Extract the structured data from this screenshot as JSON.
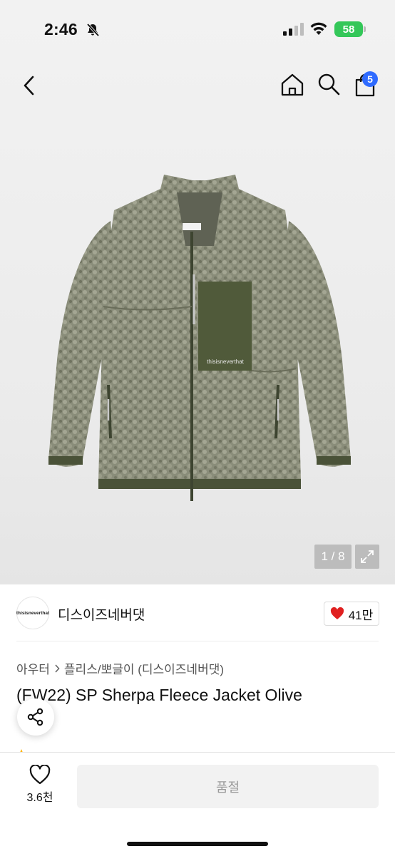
{
  "status_bar": {
    "time": "2:46",
    "battery": "58"
  },
  "product_image": {
    "counter": "1 / 8",
    "print_label": "thisisneverthat"
  },
  "header": {
    "cart_badge": "5"
  },
  "brand": {
    "logo_text": "thisisneverthat",
    "name": "디스이즈네버댓",
    "likes": "41만"
  },
  "breadcrumb": {
    "category": "아우터",
    "sub_category": "플리스/뽀글이 (디스이즈네버댓)"
  },
  "product": {
    "title": "(FW22) SP Sherpa Fleece Jacket Olive"
  },
  "bottom_bar": {
    "wish_count": "3.6천",
    "purchase_label": "품절"
  },
  "colors": {
    "accent": "#2f6bff",
    "heart": "#e02020",
    "battery": "#34c759"
  }
}
